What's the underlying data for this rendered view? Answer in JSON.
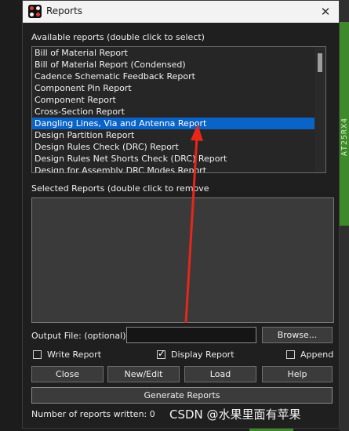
{
  "background": {
    "side_text": "AT25RX4"
  },
  "window": {
    "title": "Reports",
    "close_glyph": "✕",
    "icon": "app-icon"
  },
  "available": {
    "label": "Available reports (double click to select)",
    "items": [
      "Bill of Material Report",
      "Bill of Material Report (Condensed)",
      "Cadence Schematic Feedback Report",
      "Component Pin Report",
      "Component Report",
      "Cross-Section Report",
      "Dangling Lines, Via and Antenna Report",
      "Design Partition Report",
      "Design Rules Check (DRC) Report",
      "Design Rules Net Shorts Check (DRC) Report",
      "Design for Assembly DRC Modes Report"
    ],
    "selected_index": 6
  },
  "selected": {
    "label": "Selected Reports (double click to remove"
  },
  "output": {
    "label": "Output File: (optional)",
    "value": "",
    "browse_label": "Browse..."
  },
  "options": {
    "write_report": {
      "label": "Write Report",
      "checked": false
    },
    "display_report": {
      "label": "Display Report",
      "checked": true
    },
    "append": {
      "label": "Append",
      "checked": false
    }
  },
  "buttons": {
    "close": "Close",
    "new_edit": "New/Edit",
    "load": "Load",
    "help": "Help",
    "generate": "Generate Reports"
  },
  "status": {
    "text": "Number of reports written: 0"
  },
  "watermark": "CSDN @水果里面有苹果",
  "colors": {
    "selection": "#0a64c8",
    "arrow": "#e8261a",
    "titlebar": "#f3f3f3"
  }
}
